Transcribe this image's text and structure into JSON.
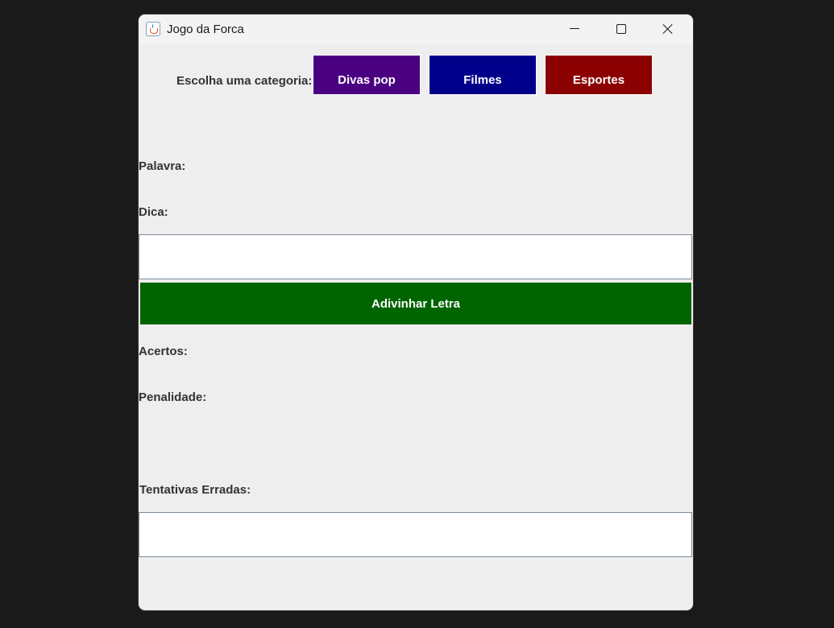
{
  "window": {
    "title": "Jogo da Forca"
  },
  "categories": {
    "label": "Escolha uma categoria:",
    "buttons": [
      {
        "label": "Divas pop",
        "color": "#4b0082"
      },
      {
        "label": "Filmes",
        "color": "#00008b"
      },
      {
        "label": "Esportes",
        "color": "#8b0000"
      }
    ]
  },
  "game": {
    "word_label": "Palavra:",
    "hint_label": "Dica:",
    "letter_input_value": "",
    "guess_button_label": "Adivinhar Letra",
    "hits_label": "Acertos:",
    "penalty_label": "Penalidade:",
    "wrong_attempts_label": "Tentativas Erradas:",
    "wrong_attempts_value": ""
  },
  "colors": {
    "guess_button": "#006400",
    "background": "#eeeeee"
  }
}
